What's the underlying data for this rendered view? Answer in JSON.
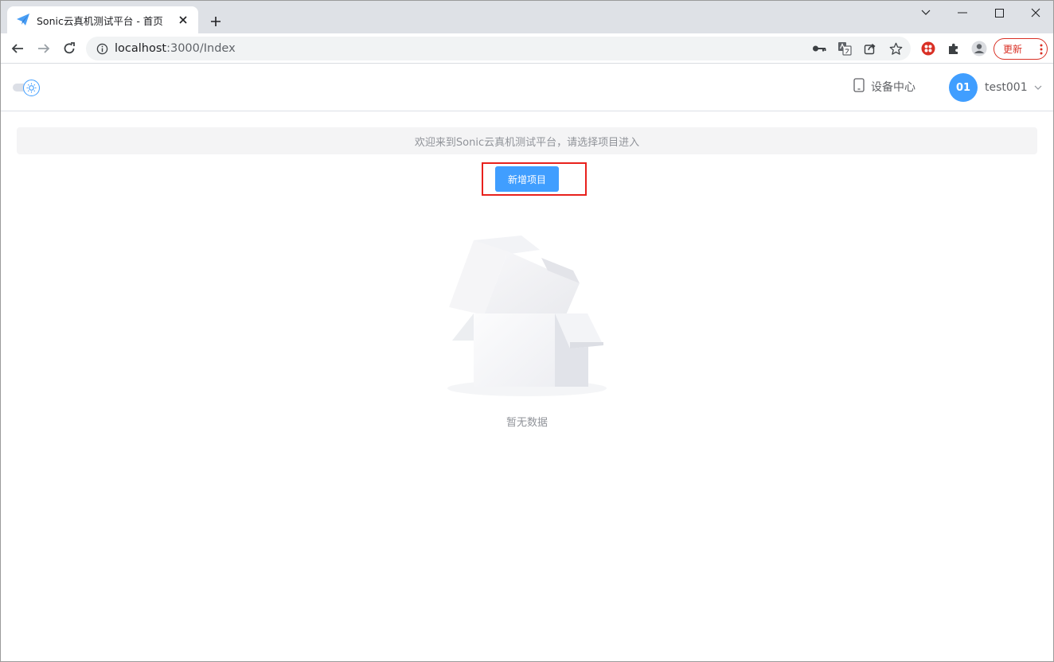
{
  "browser": {
    "tab": {
      "title": "Sonic云真机测试平台 - 首页"
    },
    "address": {
      "host": "localhost",
      "path": ":3000/Index"
    },
    "update_label": "更新"
  },
  "header": {
    "device_center_label": "设备中心",
    "user": {
      "avatar_text": "01",
      "name": "test001"
    }
  },
  "main": {
    "welcome_text": "欢迎来到Sonic云真机测试平台，请选择项目进入",
    "add_project_label": "新增项目",
    "empty_text": "暂无数据"
  },
  "colors": {
    "primary": "#409eff",
    "highlight": "#e8211d",
    "update_red": "#d93025"
  }
}
